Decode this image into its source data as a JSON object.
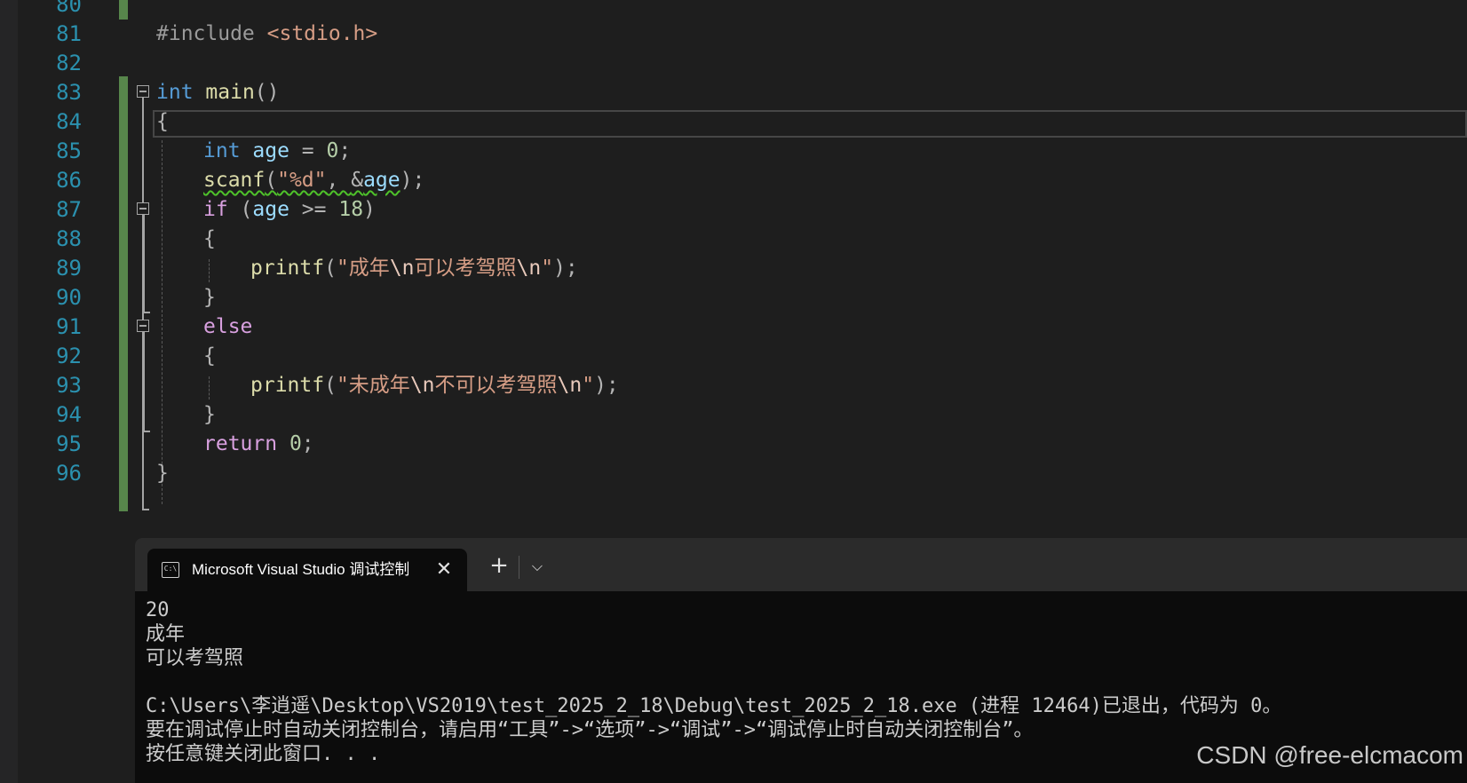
{
  "editor": {
    "line_numbers": [
      "80",
      "81",
      "82",
      "83",
      "84",
      "85",
      "86",
      "87",
      "88",
      "89",
      "90",
      "91",
      "92",
      "93",
      "94",
      "95",
      "96"
    ],
    "code": {
      "l81_include": "#include ",
      "l81_header": "<stdio.h>",
      "l83_int": "int",
      "l83_main": "main",
      "l83_parens": "()",
      "l84_brace": "{",
      "l85_int": "int",
      "l85_age": "age",
      "l85_eq": " = ",
      "l85_zero": "0",
      "l85_semi": ";",
      "l86_scanf": "scanf",
      "l86_open": "(",
      "l86_fmt": "\"%d\"",
      "l86_comma": ", ",
      "l86_amp": "&",
      "l86_age": "age",
      "l86_close": ");",
      "l87_if": "if",
      "l87_open": " (",
      "l87_age": "age",
      "l87_ge": " >= ",
      "l87_num": "18",
      "l87_close": ")",
      "l88_brace": "{",
      "l89_printf": "printf",
      "l89_open": "(",
      "l89_q1": "\"成年",
      "l89_esc1": "\\n",
      "l89_mid": "可以考驾照",
      "l89_esc2": "\\n",
      "l89_q2": "\"",
      "l89_close": ");",
      "l90_brace": "}",
      "l91_else": "else",
      "l92_brace": "{",
      "l93_printf": "printf",
      "l93_open": "(",
      "l93_q1": "\"未成年",
      "l93_esc1": "\\n",
      "l93_mid": "不可以考驾照",
      "l93_esc2": "\\n",
      "l93_q2": "\"",
      "l93_close": ");",
      "l94_brace": "}",
      "l95_return": "return",
      "l95_zero": " 0",
      "l95_semi": ";",
      "l96_brace": "}"
    }
  },
  "console": {
    "tab_icon_text": "C:\\",
    "tab_title": "Microsoft Visual Studio 调试控制台",
    "close_glyph": "✕",
    "new_tab_glyph": "+",
    "dropdown_glyph": "⌵",
    "output": [
      "20",
      "成年",
      "可以考驾照",
      "",
      "C:\\Users\\李逍遥\\Desktop\\VS2019\\test_2025_2_18\\Debug\\test_2025_2_18.exe (进程 12464)已退出，代码为 0。",
      "要在调试停止时自动关闭控制台，请启用“工具”->“选项”->“调试”->“调试停止时自动关闭控制台”。",
      "按任意键关闭此窗口. . ."
    ]
  },
  "watermark": "CSDN @free-elcmacom",
  "colors": {
    "background": "#1e1e1e",
    "line_number": "#2b91af",
    "keyword": "#569cd6",
    "control": "#d8a0df",
    "function": "#dcdcaa",
    "variable": "#9cdcfe",
    "number": "#b5cea8",
    "string": "#d69d85",
    "change_bar": "#57864b",
    "console_bg": "#0c0c0c"
  }
}
